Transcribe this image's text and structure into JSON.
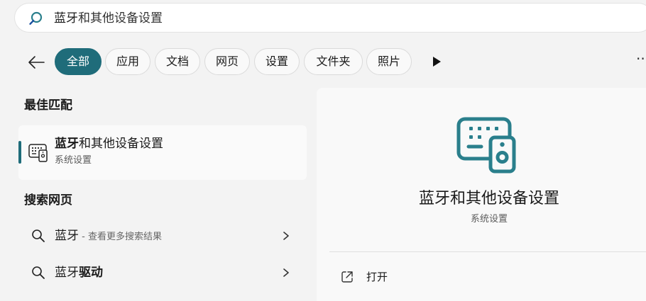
{
  "search": {
    "query_bold": "蓝牙",
    "query_rest": "和其他设备设置"
  },
  "filters": {
    "items": [
      {
        "label": "全部",
        "active": true
      },
      {
        "label": "应用",
        "active": false
      },
      {
        "label": "文档",
        "active": false
      },
      {
        "label": "网页",
        "active": false
      },
      {
        "label": "设置",
        "active": false
      },
      {
        "label": "文件夹",
        "active": false
      },
      {
        "label": "照片",
        "active": false
      }
    ],
    "more_label": "···"
  },
  "best_match": {
    "section_title": "最佳匹配",
    "title_bold": "蓝牙",
    "title_rest": "和其他设备设置",
    "subtitle": "系统设置",
    "icon": "bluetooth-devices-icon"
  },
  "web": {
    "section_title": "搜索网页",
    "results": [
      {
        "main": "蓝牙",
        "suffix": " - 查看更多搜索结果"
      },
      {
        "main": "蓝牙",
        "suffix_bold": "驱动"
      }
    ]
  },
  "detail": {
    "title": "蓝牙和其他设备设置",
    "subtitle": "系统设置",
    "actions": [
      {
        "label": "打开",
        "icon": "open-external-icon"
      }
    ]
  },
  "colors": {
    "accent": "#1f6c7a",
    "icon_teal": "#2a7f8c",
    "background": "#f3f3f3"
  }
}
